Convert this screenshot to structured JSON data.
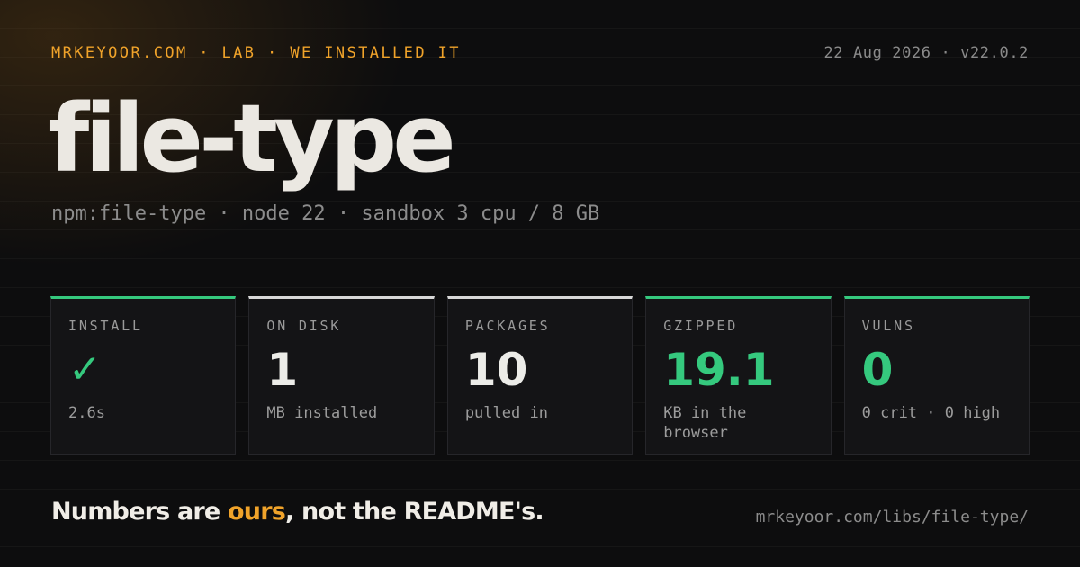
{
  "header": {
    "kicker": "MRKEYOOR.COM · LAB · WE INSTALLED IT",
    "meta": "22 Aug 2026 · v22.0.2"
  },
  "title": "file-type",
  "subtitle": "npm:file-type · node 22 · sandbox 3 cpu / 8 GB",
  "cards": [
    {
      "label": "INSTALL",
      "value": "✓",
      "sub": "2.6s",
      "accent": "#35c97e",
      "value_color": "#35c97e"
    },
    {
      "label": "ON DISK",
      "value": "1",
      "sub": "MB installed",
      "accent": "#d8d8d8",
      "value_color": "#ecece8"
    },
    {
      "label": "PACKAGES",
      "value": "10",
      "sub": "pulled in",
      "accent": "#d8d8d8",
      "value_color": "#ecece8"
    },
    {
      "label": "GZIPPED",
      "value": "19.1",
      "sub": "KB in the browser",
      "accent": "#35c97e",
      "value_color": "#35c97e"
    },
    {
      "label": "VULNS",
      "value": "0",
      "sub": "0 crit · 0 high",
      "accent": "#35c97e",
      "value_color": "#35c97e"
    }
  ],
  "footer": {
    "tagline_prefix": "Numbers are ",
    "tagline_highlight": "ours",
    "tagline_suffix": ", not the README's.",
    "url": "mrkeyoor.com/libs/file-type/"
  },
  "colors": {
    "background": "#0d0d0e",
    "accent_orange": "#f0a32a",
    "accent_green": "#35c97e"
  }
}
